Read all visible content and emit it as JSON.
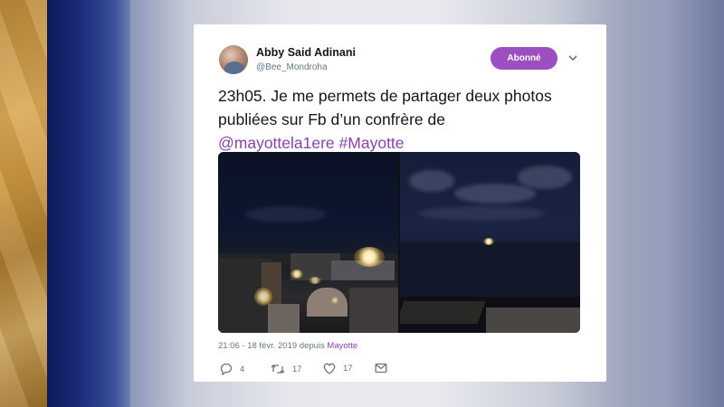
{
  "tweet": {
    "author_name": "Abby Said Adinani",
    "author_handle": "@Bee_Mondroha",
    "follow_label": "Abonné",
    "text_plain": "23h05. Je me permets de partager deux photos publiées sur Fb d’un confrère de",
    "mention": "@mayottela1ere",
    "hashtag": "#Mayotte",
    "timestamp": "21:06 - 18 févr. 2019 depuis",
    "location": "Mayotte",
    "replies": "4",
    "retweets": "17",
    "likes": "17"
  },
  "icons": {
    "avatar": "user-avatar",
    "menu": "chevron-down-icon",
    "reply": "reply-icon",
    "retweet": "retweet-icon",
    "like": "heart-icon",
    "dm": "message-icon"
  },
  "colors": {
    "accent": "#9c4fc0",
    "link": "#8e3fb4",
    "text": "#14171a",
    "muted": "#657786"
  }
}
